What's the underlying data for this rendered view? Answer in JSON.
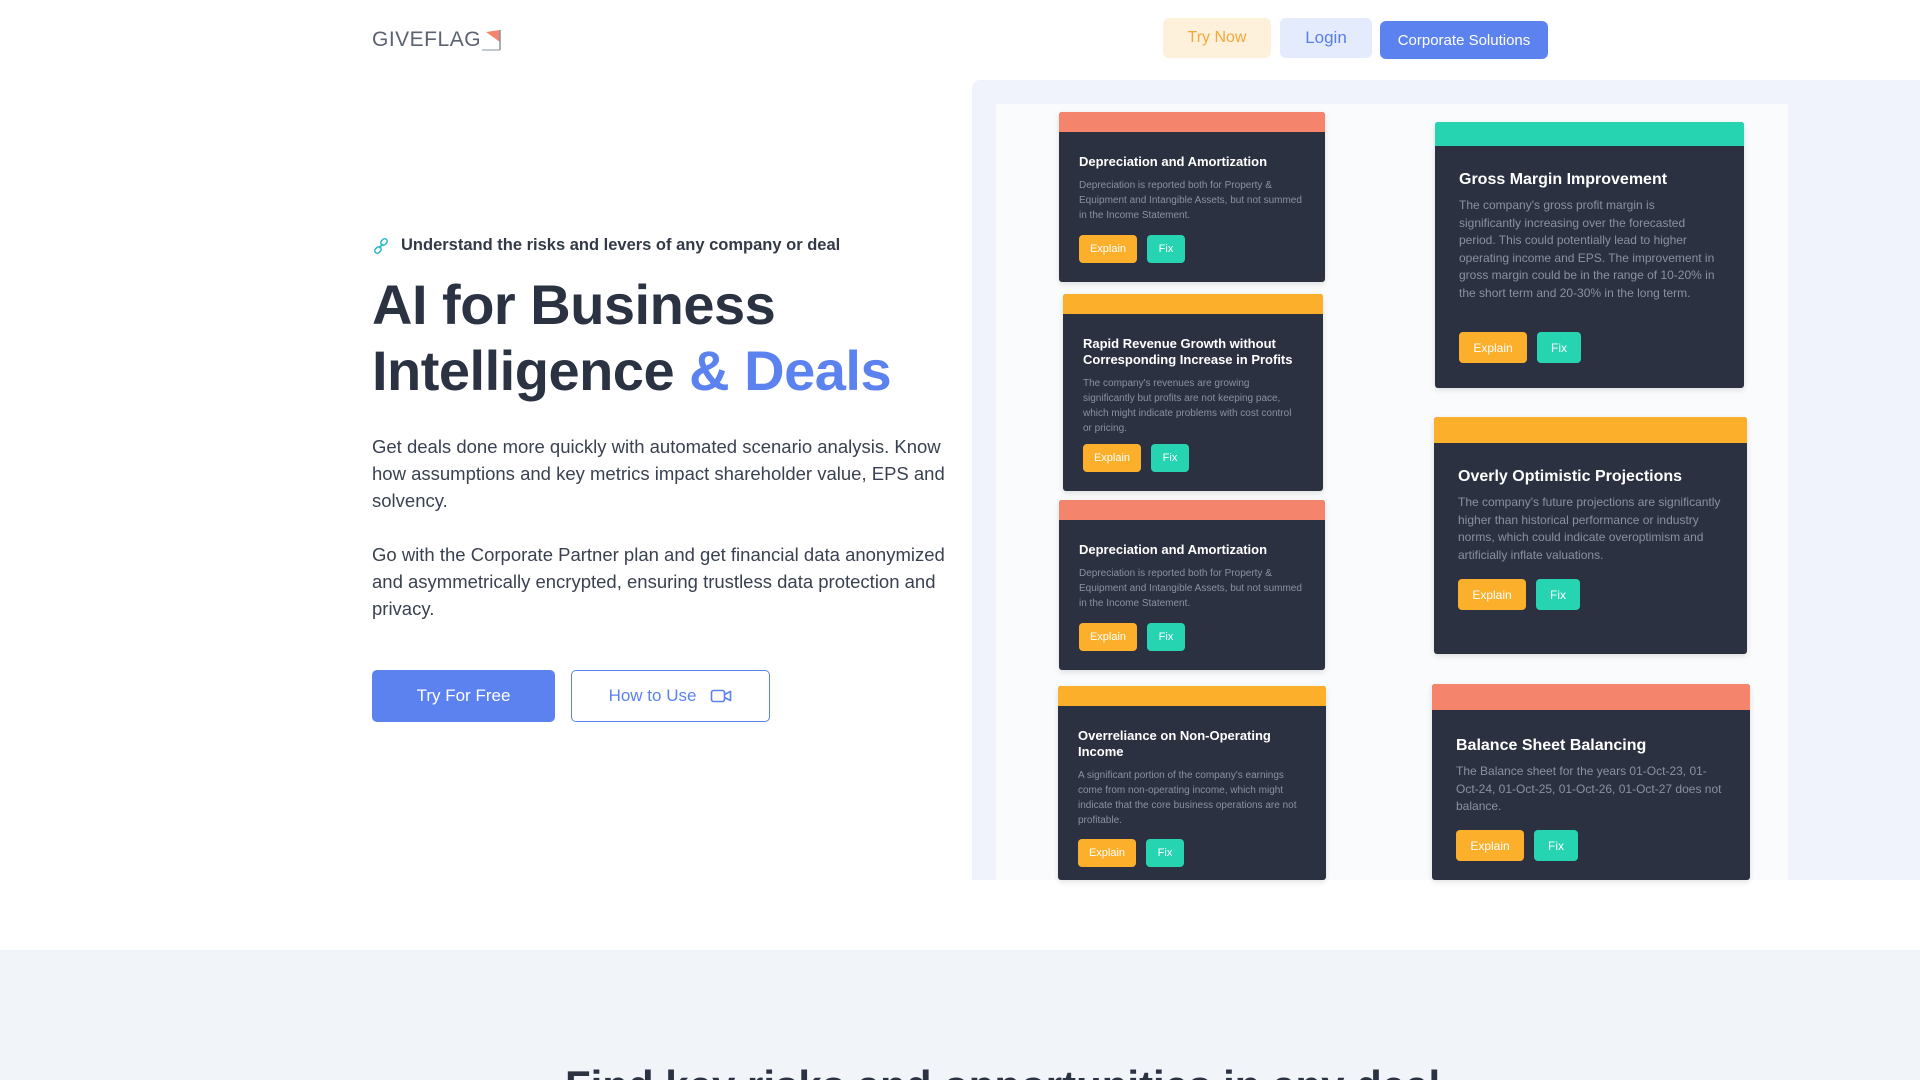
{
  "header": {
    "logo_text": "GIVEFLAG",
    "try_now_label": "Try Now",
    "login_label": "Login",
    "corporate_label": "Corporate Solutions"
  },
  "hero": {
    "tagline": "Understand the risks and levers of any company or deal",
    "title_line1": "AI for Business",
    "title_line2": "Intelligence",
    "title_accent": "& Deals",
    "paragraph1": "Get deals done more quickly with automated scenario analysis. Know how assumptions and key metrics impact shareholder value, EPS and solvency.",
    "paragraph2": "Go with the Corporate Partner plan and get financial data anonymized and asymmetrically encrypted, ensuring trustless data protection and privacy.",
    "try_free_label": "Try For Free",
    "how_to_use_label": "How to Use"
  },
  "cards": {
    "c1": {
      "title": "Depreciation and Amortization",
      "body": "Depreciation is reported both for Property & Equipment and Intangible Assets, but not summed in the Income Statement.",
      "explain": "Explain",
      "fix": "Fix"
    },
    "c2": {
      "title": "Rapid Revenue Growth without Corresponding Increase in Profits",
      "body": "The company's revenues are growing significantly but profits are not keeping pace, which might indicate problems with cost control or pricing.",
      "explain": "Explain",
      "fix": "Fix"
    },
    "c3": {
      "title": "Depreciation and Amortization",
      "body": "Depreciation is reported both for Property & Equipment and Intangible Assets, but not summed in the Income Statement.",
      "explain": "Explain",
      "fix": "Fix"
    },
    "c4": {
      "title": "Overreliance on Non-Operating Income",
      "body": "A significant portion of the company's earnings come from non-operating income, which might indicate that the core business operations are not profitable.",
      "explain": "Explain",
      "fix": "Fix"
    },
    "c5": {
      "title": "Gross Margin Improvement",
      "body": "The company's gross profit margin is significantly increasing over the forecasted period. This could potentially lead to higher operating income and EPS. The improvement in gross margin could be in the range of 10-20% in the short term and 20-30% in the long term.",
      "explain": "Explain",
      "fix": "Fix"
    },
    "c6": {
      "title": "Overly Optimistic Projections",
      "body": "The company's future projections are significantly higher than historical performance or industry norms, which could indicate overoptimism and artificially inflate valuations.",
      "explain": "Explain",
      "fix": "Fix"
    },
    "c7": {
      "title": "Balance Sheet Balancing",
      "body": "The Balance sheet for the years 01-Oct-23, 01-Oct-24, 01-Oct-25, 01-Oct-26, 01-Oct-27 does not balance.",
      "explain": "Explain",
      "fix": "Fix"
    }
  },
  "lower": {
    "heading": "Find key risks and opportunities in any deal"
  },
  "colors": {
    "accent": "#5c82f0",
    "red_bar": "#f5846c",
    "orange_bar": "#fbaf2b",
    "teal_bar": "#26d4b2",
    "card_bg": "#2b3140"
  },
  "icons": [
    "flag-icon",
    "link-icon",
    "video-camera-icon"
  ]
}
